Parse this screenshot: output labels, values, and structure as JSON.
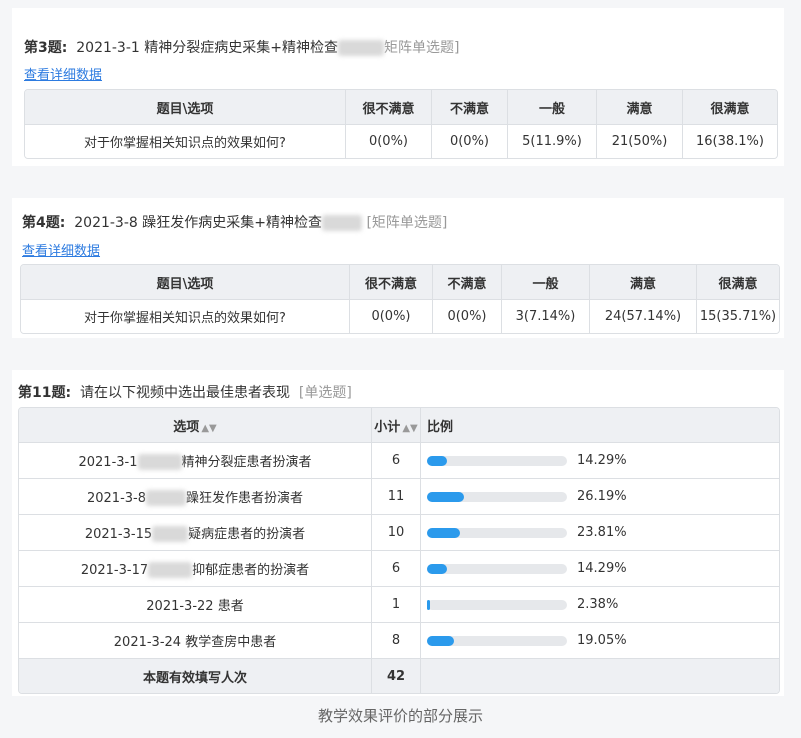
{
  "q3": {
    "num": "第3题:",
    "title": "2021-3-1 精神分裂症病史采集+精神检查",
    "type": "矩阵单选题]",
    "link": "查看详细数据",
    "headers": [
      "题目\\选项",
      "很不满意",
      "不满意",
      "一般",
      "满意",
      "很满意"
    ],
    "row": [
      "对于你掌握相关知识点的效果如何?",
      "0(0%)",
      "0(0%)",
      "5(11.9%)",
      "21(50%)",
      "16(38.1%)"
    ]
  },
  "q4": {
    "num": "第4题:",
    "title": "2021-3-8 躁狂发作病史采集+精神检查",
    "type": "[矩阵单选题]",
    "link": "查看详细数据",
    "headers": [
      "题目\\选项",
      "很不满意",
      "不满意",
      "一般",
      "满意",
      "很满意"
    ],
    "row": [
      "对于你掌握相关知识点的效果如何?",
      "0(0%)",
      "0(0%)",
      "3(7.14%)",
      "24(57.14%)",
      "15(35.71%)"
    ]
  },
  "q11": {
    "num": "第11题:",
    "title": "请在以下视频中选出最佳患者表现",
    "type": "[单选题]",
    "headers": {
      "option": "选项",
      "sort_icon": "sort-icon",
      "count": "小计",
      "ratio": "比例"
    },
    "rows": [
      {
        "pre": "2021-3-1",
        "post": "精神分裂症患者扮演者",
        "count": "6",
        "pct": "14.29%",
        "value": 0.1429
      },
      {
        "pre": "2021-3-8",
        "post": "躁狂发作患者扮演者",
        "count": "11",
        "pct": "26.19%",
        "value": 0.2619
      },
      {
        "pre": "2021-3-15",
        "post": "疑病症患者的扮演者",
        "count": "10",
        "pct": "23.81%",
        "value": 0.2381
      },
      {
        "pre": "2021-3-17",
        "post": "抑郁症患者的扮演者",
        "count": "6",
        "pct": "14.29%",
        "value": 0.1429
      },
      {
        "pre": "2021-3-22 患者",
        "post": "",
        "count": "1",
        "pct": "2.38%",
        "value": 0.0238
      },
      {
        "pre": "2021-3-24 教学查房中患者",
        "post": "",
        "count": "8",
        "pct": "19.05%",
        "value": 0.1905
      }
    ],
    "total_label": "本题有效填写人次",
    "total": "42"
  },
  "caption": "教学效果评价的部分展示",
  "colors": {
    "bar": "#2b9aec",
    "link": "#2d7be0"
  }
}
